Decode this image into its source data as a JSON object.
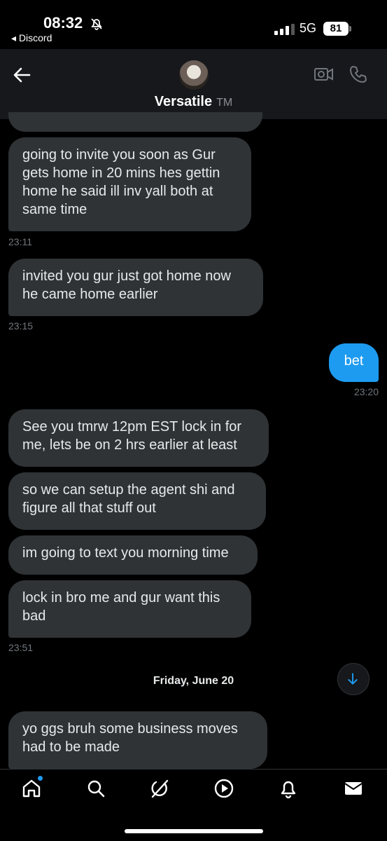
{
  "status": {
    "time": "08:32",
    "back_app": "◂ Discord",
    "network": "5G",
    "battery": "81"
  },
  "header": {
    "name": "Versatile",
    "tm": "TM"
  },
  "messages": [
    {
      "text": "going to invite you soon as Gur gets home in 20 mins hes gettin home he said ill inv  yall both at same time",
      "time": "23:11"
    },
    {
      "text": "invited you gur just got home now he came home earlier",
      "time": "23:15"
    },
    {
      "text": "bet",
      "time": "23:20",
      "outgoing": true
    },
    {
      "text": "See you tmrw 12pm EST lock in for me, lets be on 2 hrs earlier at least"
    },
    {
      "text": "so we can setup the agent shi and figure all that stuff out"
    },
    {
      "text": "im going to text you morning time"
    },
    {
      "text": "lock in bro me and gur want this bad",
      "time": "23:51"
    },
    {
      "text": "yo ggs bruh some business moves had to be made"
    }
  ],
  "date_separator": "Friday, June 20",
  "tabs": [
    "home",
    "search",
    "grok",
    "play",
    "notifications",
    "messages"
  ],
  "colors": {
    "accent": "#1d9bf0",
    "bubble_in": "#2f3336",
    "background": "#000000"
  }
}
